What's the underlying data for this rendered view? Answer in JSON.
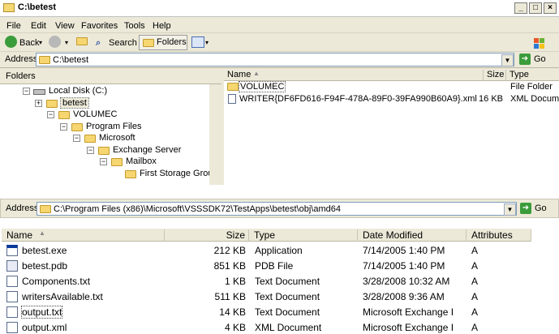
{
  "top": {
    "title": "C:\\betest",
    "menu": [
      "File",
      "Edit",
      "View",
      "Favorites",
      "Tools",
      "Help"
    ],
    "toolbar": {
      "back": "Back",
      "search": "Search",
      "folders": "Folders"
    },
    "address_label": "Address",
    "address_value": "C:\\betest",
    "go": "Go",
    "folders_title": "Folders",
    "tree": [
      {
        "label": "Local Disk (C:)",
        "expander": "−"
      },
      {
        "label": "betest",
        "expander": "+"
      },
      {
        "label": "VOLUMEC",
        "expander": "−"
      },
      {
        "label": "Program Files",
        "expander": "−"
      },
      {
        "label": "Microsoft",
        "expander": "−"
      },
      {
        "label": "Exchange Server",
        "expander": "−"
      },
      {
        "label": "Mailbox",
        "expander": "−"
      },
      {
        "label": "First Storage Group",
        "expander": ""
      }
    ],
    "columns": {
      "name": "Name",
      "size": "Size",
      "type": "Type"
    },
    "files": [
      {
        "name": "VOLUMEC",
        "size": "",
        "type": "File Folder"
      },
      {
        "name": "WRITER{DF6FD616-F94F-478A-89F0-39FA990B60A9}.xml",
        "size": "16 KB",
        "type": "XML Documer"
      }
    ]
  },
  "bottom": {
    "address_label": "Address",
    "address_value": "C:\\Program Files (x86)\\Microsoft\\VSSSDK72\\TestApps\\betest\\obj\\amd64",
    "go": "Go",
    "columns": {
      "name": "Name",
      "size": "Size",
      "type": "Type",
      "modified": "Date Modified",
      "attributes": "Attributes"
    },
    "files": [
      {
        "name": "betest.exe",
        "size": "212 KB",
        "type": "Application",
        "modified": "7/14/2005 1:40 PM",
        "attr": "A"
      },
      {
        "name": "betest.pdb",
        "size": "851 KB",
        "type": "PDB File",
        "modified": "7/14/2005 1:40 PM",
        "attr": "A"
      },
      {
        "name": "Components.txt",
        "size": "1 KB",
        "type": "Text Document",
        "modified": "3/28/2008 10:32 AM",
        "attr": "A"
      },
      {
        "name": "writersAvailable.txt",
        "size": "511 KB",
        "type": "Text Document",
        "modified": "3/28/2008 9:36 AM",
        "attr": "A"
      },
      {
        "name": "output.txt",
        "size": "14 KB",
        "type": "Text Document",
        "modified": "Microsoft Exchange I",
        "attr": "A"
      },
      {
        "name": "output.xml",
        "size": "4 KB",
        "type": "XML Document",
        "modified": "Microsoft Exchange I",
        "attr": "A"
      }
    ]
  }
}
